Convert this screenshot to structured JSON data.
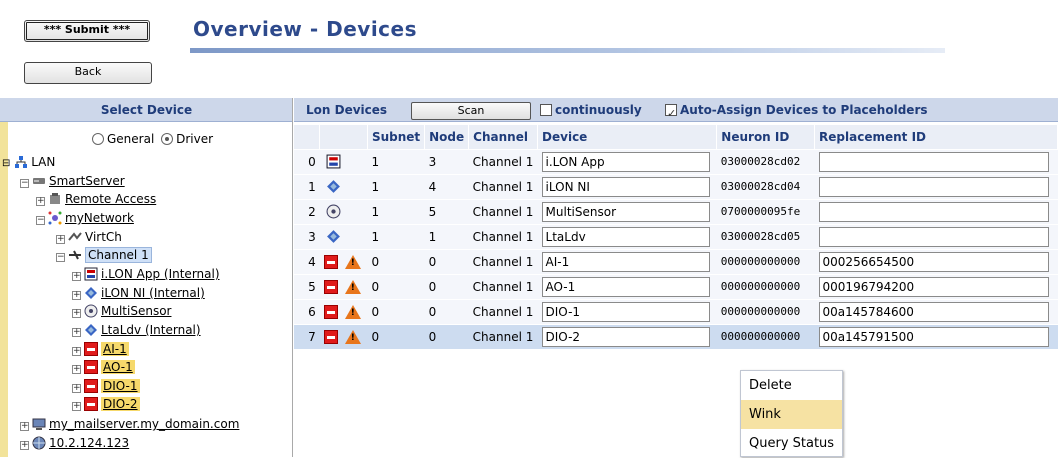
{
  "header": {
    "submit_label": "*** Submit ***",
    "back_label": "Back",
    "title": "Overview - Devices"
  },
  "left": {
    "heading": "Select Device",
    "radio_general": "General",
    "radio_driver": "Driver",
    "selected_radio": "Driver",
    "tree": {
      "lan": "LAN",
      "smartserver": "SmartServer",
      "remote_access": "Remote Access",
      "mynetwork": "myNetwork",
      "virtch": "VirtCh",
      "channel1": "Channel 1",
      "ilon_app": "i.LON App (Internal)",
      "ilon_ni": "iLON NI (Internal)",
      "multisensor": "MultiSensor",
      "ltaldv": "LtaLdv (Internal)",
      "ai1": "AI-1",
      "ao1": "AO-1",
      "dio1": "DIO-1",
      "dio2": "DIO-2",
      "mail": "my_mailserver.my_domain.com",
      "ip": "10.2.124.123"
    }
  },
  "toolbar": {
    "lon_devices": "Lon Devices",
    "scan_label": "Scan",
    "continuously": "continuously",
    "continuously_checked": false,
    "auto_assign": "Auto-Assign Devices to Placeholders",
    "auto_assign_checked": true
  },
  "columns": {
    "subnet": "Subnet",
    "node": "Node",
    "channel": "Channel",
    "device": "Device",
    "neuron_id": "Neuron ID",
    "replacement_id": "Replacement ID"
  },
  "rows": [
    {
      "idx": "0",
      "subnet": "1",
      "node": "3",
      "channel": "Channel 1",
      "device": "i.LON App",
      "neuron": "03000028cd02",
      "replacement": ""
    },
    {
      "idx": "1",
      "subnet": "1",
      "node": "4",
      "channel": "Channel 1",
      "device": "iLON NI",
      "neuron": "03000028cd04",
      "replacement": ""
    },
    {
      "idx": "2",
      "subnet": "1",
      "node": "5",
      "channel": "Channel 1",
      "device": "MultiSensor",
      "neuron": "0700000095fe",
      "replacement": ""
    },
    {
      "idx": "3",
      "subnet": "1",
      "node": "1",
      "channel": "Channel 1",
      "device": "LtaLdv",
      "neuron": "03000028cd05",
      "replacement": ""
    },
    {
      "idx": "4",
      "subnet": "0",
      "node": "0",
      "channel": "Channel 1",
      "device": "AI-1",
      "neuron": "000000000000",
      "replacement": "000256654500"
    },
    {
      "idx": "5",
      "subnet": "0",
      "node": "0",
      "channel": "Channel 1",
      "device": "AO-1",
      "neuron": "000000000000",
      "replacement": "000196794200"
    },
    {
      "idx": "6",
      "subnet": "0",
      "node": "0",
      "channel": "Channel 1",
      "device": "DIO-1",
      "neuron": "000000000000",
      "replacement": "00a145784600"
    },
    {
      "idx": "7",
      "subnet": "0",
      "node": "0",
      "channel": "Channel 1",
      "device": "DIO-2",
      "neuron": "000000000000",
      "replacement": "00a145791500"
    }
  ],
  "context_menu": {
    "items": [
      "Delete",
      "Wink",
      "Query Status"
    ],
    "hovered": "Wink"
  }
}
